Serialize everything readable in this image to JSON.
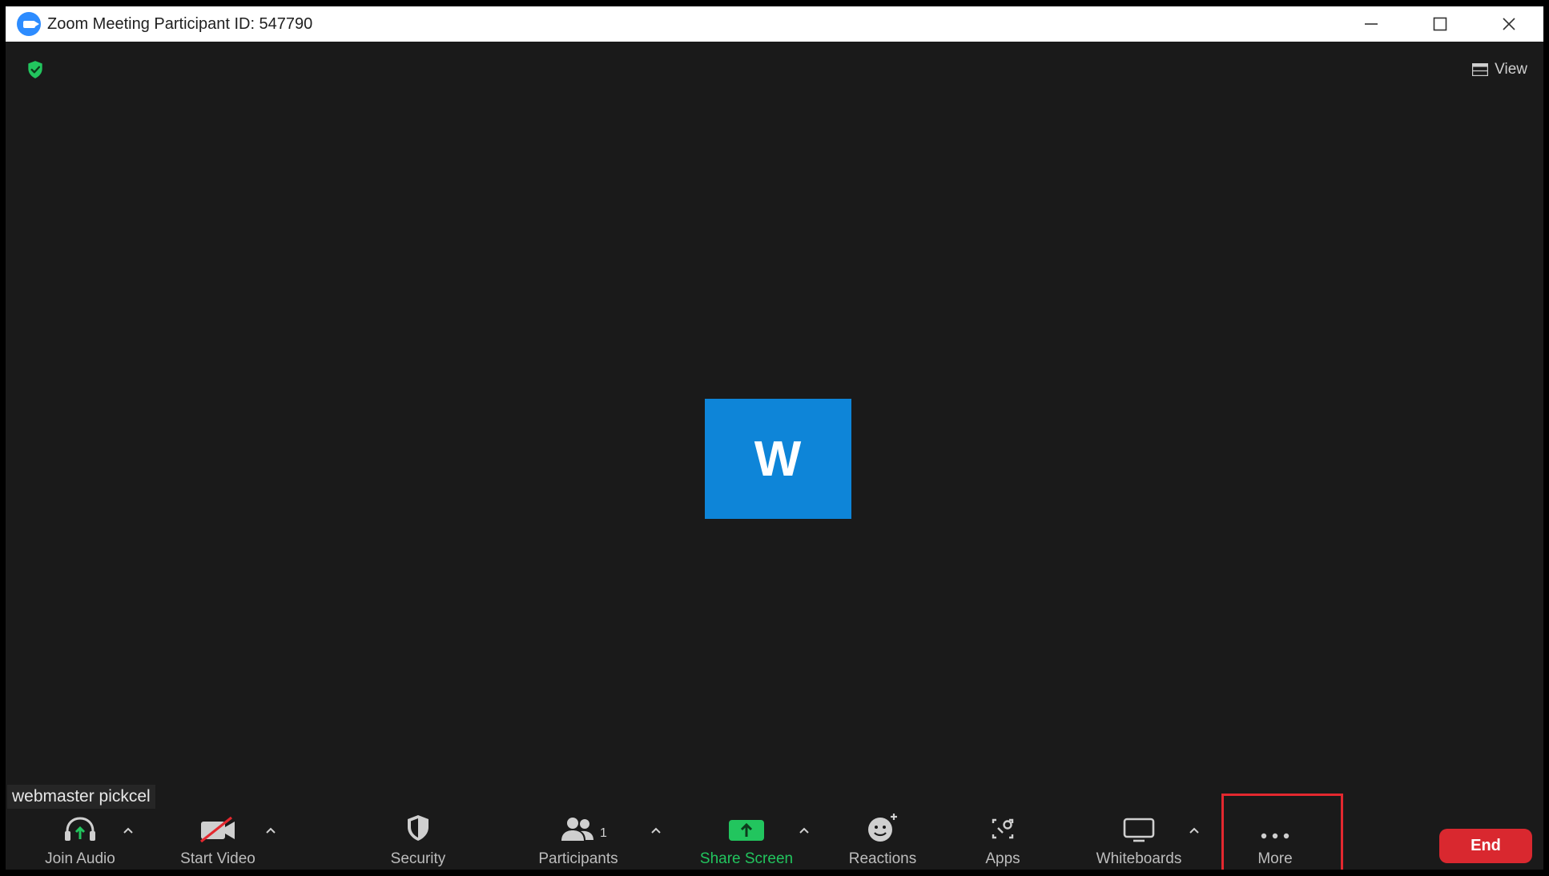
{
  "window": {
    "title": "Zoom Meeting Participant ID: 547790"
  },
  "meeting": {
    "view_label": "View",
    "avatar_initial": "W",
    "participant_name": "webmaster pickcel"
  },
  "toolbar": {
    "join_audio": "Join Audio",
    "start_video": "Start Video",
    "security": "Security",
    "participants": "Participants",
    "participants_count": "1",
    "share_screen": "Share Screen",
    "reactions": "Reactions",
    "apps": "Apps",
    "whiteboards": "Whiteboards",
    "more": "More",
    "end": "End"
  },
  "colors": {
    "accent": "#2d8cff",
    "share_green": "#22c55e",
    "end_red": "#d9282f",
    "highlight_red": "#e3282f",
    "avatar_blue": "#0e85d8"
  }
}
